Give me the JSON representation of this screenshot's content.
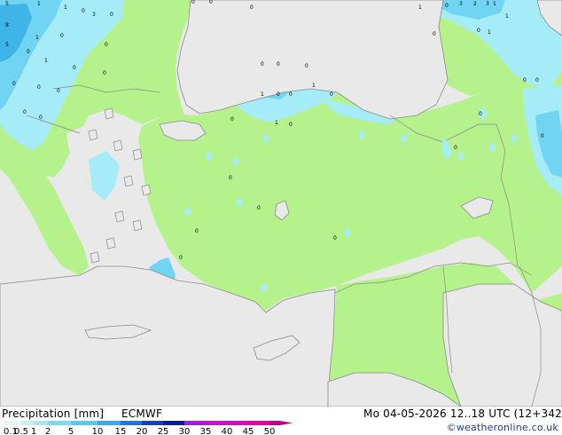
{
  "footer": {
    "title": "Precipitation [mm]",
    "model": "ECMWF",
    "validity": "Mo 04-05-2026 12..18 UTC (12+342",
    "credit": "©weatheronline.co.uk"
  },
  "legend": {
    "ticks": [
      "0.1",
      "0.5",
      "1",
      "2",
      "5",
      "10",
      "15",
      "20",
      "25",
      "30",
      "35",
      "40",
      "45",
      "50"
    ],
    "colors": [
      "#e6f7fb",
      "#c8f0f7",
      "#a8e6f2",
      "#7fdaf0",
      "#58cbec",
      "#38a8e6",
      "#1f78d8",
      "#1440b8",
      "#0d1e8a",
      "#a020d8",
      "#c018c8",
      "#d010b8",
      "#e008a0",
      "#c0007f"
    ]
  },
  "map": {
    "colors": {
      "sea": "#e9e9e9",
      "land_no_precip": "#e9e9e9",
      "precip_land": "#b6f28b",
      "precip_light": "#a6ecf8",
      "precip_moderate": "#70d4f2",
      "precip_heavy": "#3fb4e8",
      "coast": "#8a8a8a"
    },
    "values": [
      "5",
      "1",
      "1",
      "0",
      "8",
      "3",
      "0",
      "0",
      "0",
      "0",
      "1",
      "0",
      "3",
      "2",
      "3",
      "1",
      "0",
      "0",
      "5",
      "0",
      "1",
      "0",
      "0",
      "0",
      "0",
      "0",
      "0",
      "0",
      "0",
      "0",
      "0",
      "1",
      "0",
      "0",
      "1",
      "0",
      "0",
      "1",
      "0",
      "0",
      "0",
      "1",
      "0",
      "0",
      "0",
      "0",
      "0",
      "0",
      "0",
      "0",
      "0",
      "1",
      "1",
      "0"
    ]
  }
}
